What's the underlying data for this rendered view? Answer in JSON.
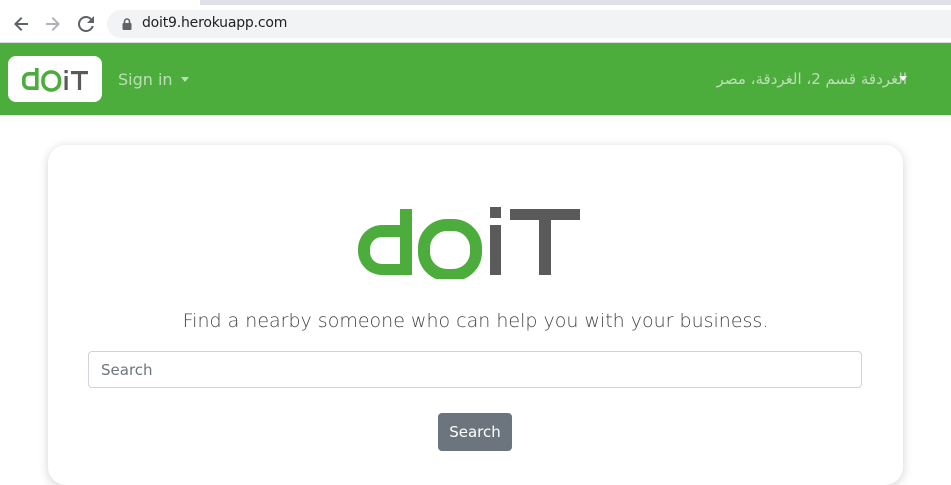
{
  "browser": {
    "url": "doit9.herokuapp.com",
    "icons": [
      "back-arrow-icon",
      "forward-arrow-icon",
      "reload-icon",
      "lock-icon"
    ]
  },
  "navbar": {
    "brand_logo": "dOiT",
    "signin_label": "Sign in",
    "location_label": "الغردقة قسم 2، الغردقة، مصر",
    "colors": {
      "background": "#4cac3c",
      "logo_green": "#4cac3c",
      "logo_gray": "#5a5a5a"
    }
  },
  "hero": {
    "logo_text": "dOiT",
    "tagline": "Find a nearby someone who can help you with your business.",
    "search_placeholder": "Search",
    "search_button": "Search"
  }
}
